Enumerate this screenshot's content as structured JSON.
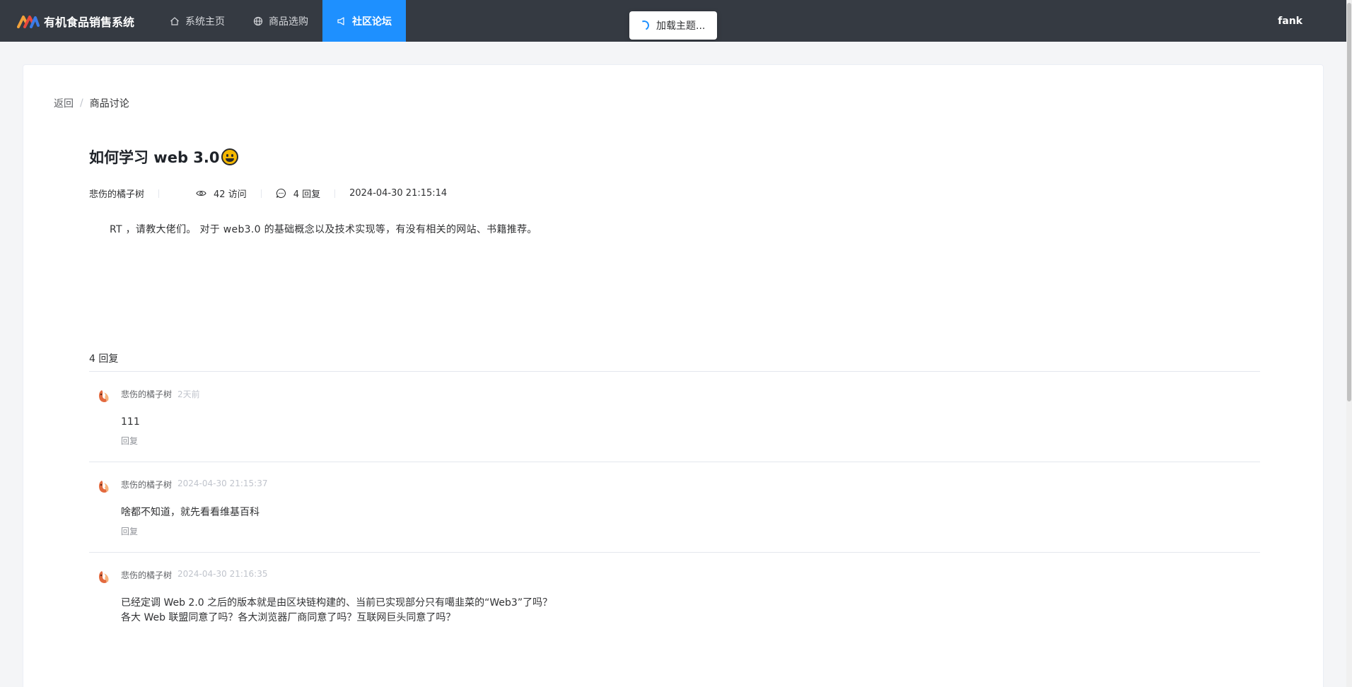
{
  "header": {
    "app_name": "有机食品销售系统",
    "nav": [
      {
        "label": "系统主页",
        "icon": "home-icon"
      },
      {
        "label": "商品选购",
        "icon": "globe-icon"
      },
      {
        "label": "社区论坛",
        "icon": "megaphone-icon"
      }
    ],
    "active_nav": "社区论坛",
    "user": "fank"
  },
  "toast": {
    "text": "加载主题..."
  },
  "breadcrumb": {
    "back": "返回",
    "separator": "/",
    "current": "商品讨论"
  },
  "post": {
    "title": "如何学习 web 3.0",
    "author": "悲伤的橘子树",
    "views": "42 访问",
    "replies": "4 回复",
    "time": "2024-04-30 21:15:14",
    "content": "RT ，请教大佬们。 对于 web3.0 的基础概念以及技术实现等，有没有相关的网站、书籍推荐。"
  },
  "reply_section": {
    "count_label": "4 回复"
  },
  "replies": [
    {
      "user": "悲伤的橘子树",
      "time": "2天前",
      "body": "111",
      "action": "回复"
    },
    {
      "user": "悲伤的橘子树",
      "time": "2024-04-30 21:15:37",
      "body": "啥都不知道，就先看看维基百科",
      "action": "回复"
    },
    {
      "user": "悲伤的橘子树",
      "time": "2024-04-30 21:16:35",
      "body_line1": "已经定调 Web 2.0 之后的版本就是由区块链构建的、当前已实现部分只有噶韭菜的“Web3”了吗？",
      "body_line2": "各大 Web 联盟同意了吗？各大浏览器厂商同意了吗？互联网巨头同意了吗？"
    }
  ],
  "colors": {
    "header_bg": "#353a42",
    "accent": "#1e90ff"
  }
}
